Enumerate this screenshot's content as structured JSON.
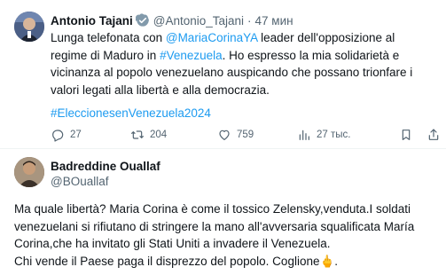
{
  "tweet": {
    "author_name": "Antonio Tajani",
    "handle": "@Antonio_Tajani",
    "separator": "·",
    "time": "47 мин",
    "text_part1": "Lunga telefonata con ",
    "mention": "@MariaCorinaYA",
    "text_part2": " leader dell'opposizione al regime di Maduro in ",
    "hashtag_inline": "#Venezuela",
    "text_part3": ". Ho espresso la mia solidarietà e vicinanza al popolo venezuelano auspicando che possano trionfare i valori legati alla libertà e alla democrazia.",
    "hashtag": "#EleccionesenVenezuela2024",
    "actions": {
      "replies": "27",
      "reposts": "204",
      "likes": "759",
      "views": "27 тыс."
    }
  },
  "reply": {
    "author_name": "Badreddine Ouallaf",
    "handle": "@BOuallaf",
    "text_line1": "Ma quale libertà? Maria Corina è come il tossico Zelensky,venduta.I soldati venezuelani si rifiutano di stringere la mano all'avversaria squalificata María Corina,che ha invitato gli Stati Uniti a invadere il Venezuela.",
    "text_line2": "Chi vende il Paese paga il disprezzo del popolo. Coglione",
    "emoji": "🖕",
    "text_end": "."
  },
  "colors": {
    "accent": "#1d9bf0",
    "text": "#0f1419",
    "secondary": "#536471"
  }
}
